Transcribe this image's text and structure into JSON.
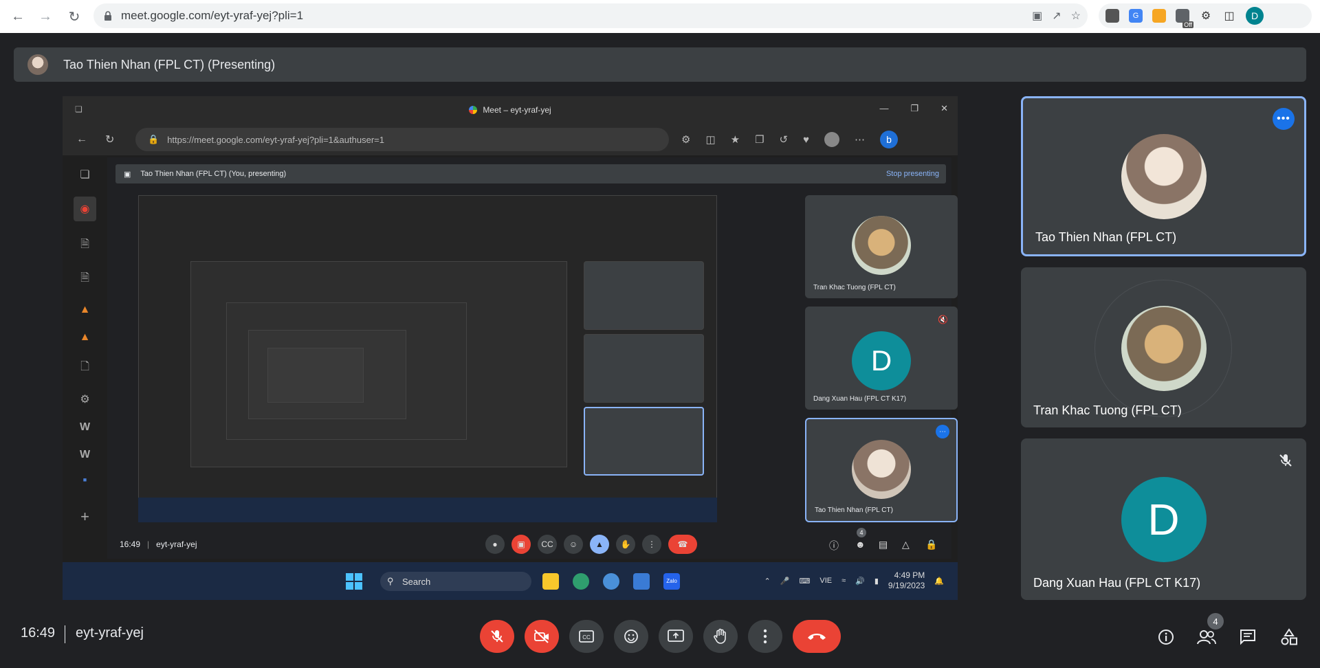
{
  "browser": {
    "url": "meet.google.com/eyt-yraf-yej?pli=1",
    "profile_initial": "D",
    "ext_off_label": "Off"
  },
  "presenting_bar": {
    "text": "Tao Thien Nhan (FPL CT) (Presenting)"
  },
  "shared_screen": {
    "window_title": "Meet – eyt-yraf-yej",
    "address": "https://meet.google.com/eyt-yraf-yej?pli=1&authuser=1",
    "presenting_text": "Tao Thien Nhan (FPL CT) (You, presenting)",
    "stop_presenting": "Stop presenting",
    "time": "16:49",
    "code": "eyt-yraf-yej",
    "tiles": [
      {
        "name": "Tran Khac Tuong (FPL CT)"
      },
      {
        "name": "Dang Xuan Hau (FPL CT K17)",
        "initial": "D"
      },
      {
        "name": "Tao Thien Nhan (FPL CT)"
      }
    ],
    "participant_count": "4",
    "taskbar": {
      "search": "Search",
      "lang": "VIE",
      "clock_time": "4:49 PM",
      "clock_date": "9/19/2023"
    }
  },
  "participants": [
    {
      "name": "Tao Thien Nhan (FPL CT)",
      "active": true
    },
    {
      "name": "Tran Khac Tuong (FPL CT)"
    },
    {
      "name": "Dang Xuan Hau (FPL CT K17)",
      "initial": "D",
      "muted": true
    }
  ],
  "bottom_bar": {
    "time": "16:49",
    "meeting_code": "eyt-yraf-yej",
    "participant_count": "4"
  },
  "colors": {
    "hangup": "#ea4335",
    "accent": "#8ab4f8",
    "teal_avatar": "#0e8e9a"
  }
}
